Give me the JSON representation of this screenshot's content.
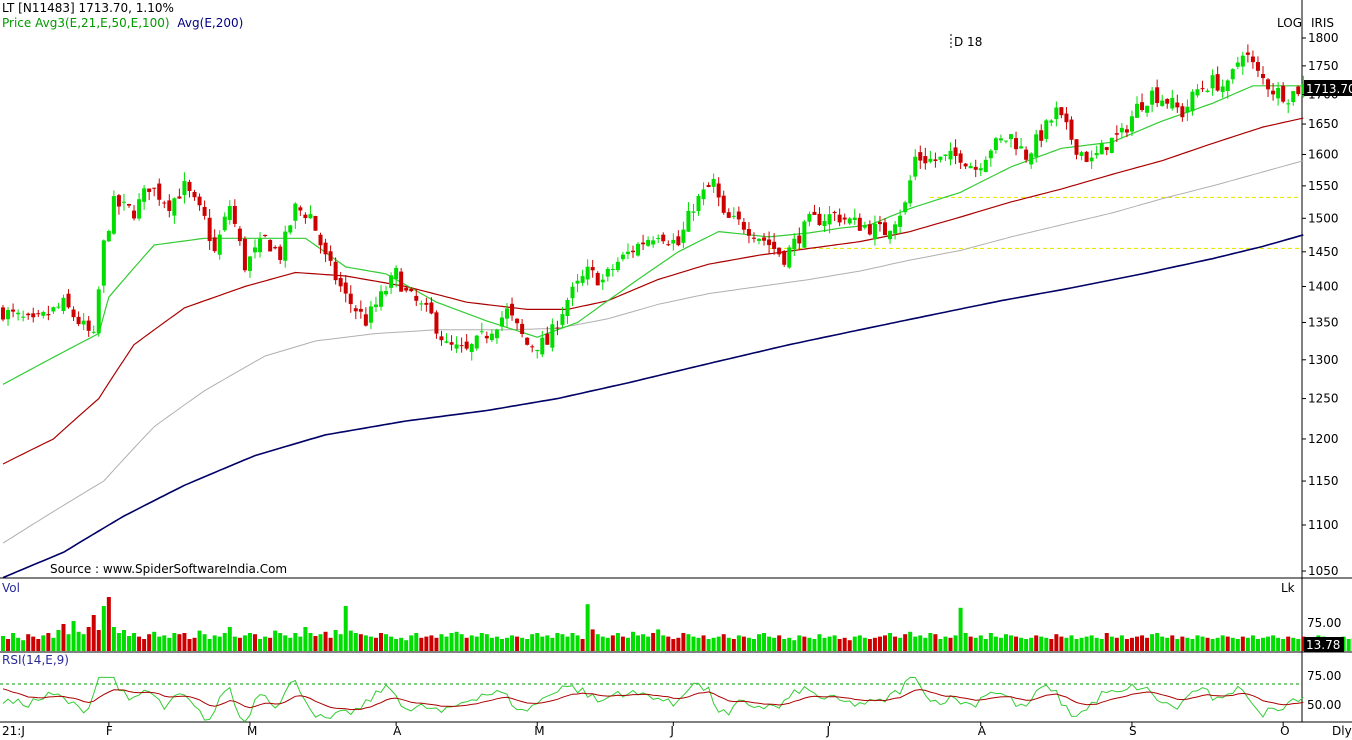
{
  "header": {
    "symbol": "LT [N11483]",
    "last_price": "1713.70",
    "change_pct": "1.10%",
    "price_label": "Price",
    "avg3_label": "Avg3(E,21,E,50,E,100)",
    "avg_label": "Avg(E,200)",
    "log_label": "LOG",
    "provider": "IRIS",
    "annotation": "D 18",
    "source": "Source : www.SpiderSoftwareIndia.Com"
  },
  "volume_panel": {
    "label": "Vol",
    "unit": "Lk",
    "last_value": "13.78",
    "tick": "75.00"
  },
  "rsi_panel": {
    "label": "RSI(14,E,9)",
    "ticks": [
      "75.00",
      "50.00"
    ]
  },
  "bottom_axis": {
    "start_label": "21:J",
    "period": "Dly"
  },
  "colors": {
    "up": "#00dd00",
    "down": "#cc0000",
    "ema21": "#33cc33",
    "ema50": "#aa0000",
    "ema100": "#b0b0b0",
    "ema200": "#000066",
    "support": "#e8e800",
    "text_blue": "#000080"
  },
  "chart_data": {
    "type": "candlestick",
    "scale": "log",
    "ylim": [
      1040,
      1820
    ],
    "y_ticks": [
      1800,
      1750,
      1700,
      1650,
      1600,
      1550,
      1500,
      1450,
      1400,
      1350,
      1300,
      1250,
      1200,
      1150,
      1100,
      1050
    ],
    "x_months": [
      {
        "label": "F",
        "index": 21
      },
      {
        "label": "M",
        "index": 49
      },
      {
        "label": "A",
        "index": 78
      },
      {
        "label": "M",
        "index": 106
      },
      {
        "label": "J",
        "index": 133
      },
      {
        "label": "J",
        "index": 164
      },
      {
        "label": "A",
        "index": 194
      },
      {
        "label": "S",
        "index": 224
      },
      {
        "label": "O",
        "index": 254
      }
    ],
    "ohlc_anchors": [
      [
        0,
        1365
      ],
      [
        6,
        1348
      ],
      [
        12,
        1375
      ],
      [
        18,
        1328
      ],
      [
        20,
        1460
      ],
      [
        22,
        1522
      ],
      [
        26,
        1510
      ],
      [
        29,
        1550
      ],
      [
        33,
        1522
      ],
      [
        36,
        1548
      ],
      [
        40,
        1498
      ],
      [
        42,
        1448
      ],
      [
        45,
        1520
      ],
      [
        48,
        1430
      ],
      [
        52,
        1468
      ],
      [
        55,
        1445
      ],
      [
        58,
        1515
      ],
      [
        61,
        1505
      ],
      [
        64,
        1440
      ],
      [
        68,
        1385
      ],
      [
        72,
        1352
      ],
      [
        75,
        1385
      ],
      [
        78,
        1418
      ],
      [
        80,
        1390
      ],
      [
        85,
        1358
      ],
      [
        88,
        1318
      ],
      [
        92,
        1310
      ],
      [
        96,
        1335
      ],
      [
        100,
        1365
      ],
      [
        104,
        1320
      ],
      [
        108,
        1322
      ],
      [
        112,
        1382
      ],
      [
        116,
        1420
      ],
      [
        119,
        1408
      ],
      [
        122,
        1435
      ],
      [
        126,
        1460
      ],
      [
        130,
        1480
      ],
      [
        134,
        1460
      ],
      [
        137,
        1520
      ],
      [
        141,
        1555
      ],
      [
        143,
        1500
      ],
      [
        147,
        1490
      ],
      [
        151,
        1468
      ],
      [
        155,
        1442
      ],
      [
        160,
        1495
      ],
      [
        165,
        1505
      ],
      [
        170,
        1490
      ],
      [
        175,
        1480
      ],
      [
        179,
        1520
      ],
      [
        181,
        1595
      ],
      [
        185,
        1590
      ],
      [
        190,
        1598
      ],
      [
        193,
        1578
      ],
      [
        196,
        1612
      ],
      [
        200,
        1630
      ],
      [
        203,
        1598
      ],
      [
        206,
        1632
      ],
      [
        209,
        1670
      ],
      [
        213,
        1612
      ],
      [
        216,
        1588
      ],
      [
        219,
        1618
      ],
      [
        222,
        1632
      ],
      [
        225,
        1678
      ],
      [
        228,
        1702
      ],
      [
        231,
        1690
      ],
      [
        234,
        1668
      ],
      [
        237,
        1708
      ],
      [
        240,
        1722
      ],
      [
        243,
        1712
      ],
      [
        246,
        1780
      ],
      [
        249,
        1735
      ],
      [
        252,
        1708
      ],
      [
        255,
        1698
      ],
      [
        258,
        1714
      ]
    ],
    "ema21": [
      [
        0,
        1268
      ],
      [
        19,
        1335
      ],
      [
        21,
        1385
      ],
      [
        30,
        1460
      ],
      [
        40,
        1470
      ],
      [
        50,
        1470
      ],
      [
        60,
        1470
      ],
      [
        68,
        1428
      ],
      [
        76,
        1418
      ],
      [
        86,
        1378
      ],
      [
        96,
        1352
      ],
      [
        106,
        1330
      ],
      [
        114,
        1350
      ],
      [
        124,
        1400
      ],
      [
        134,
        1450
      ],
      [
        142,
        1480
      ],
      [
        152,
        1472
      ],
      [
        160,
        1478
      ],
      [
        166,
        1485
      ],
      [
        172,
        1490
      ],
      [
        180,
        1515
      ],
      [
        190,
        1540
      ],
      [
        200,
        1580
      ],
      [
        210,
        1610
      ],
      [
        220,
        1620
      ],
      [
        230,
        1655
      ],
      [
        240,
        1685
      ],
      [
        248,
        1715
      ],
      [
        258,
        1715
      ]
    ],
    "ema50": [
      [
        0,
        1170
      ],
      [
        10,
        1200
      ],
      [
        19,
        1250
      ],
      [
        26,
        1320
      ],
      [
        36,
        1370
      ],
      [
        48,
        1400
      ],
      [
        58,
        1420
      ],
      [
        68,
        1415
      ],
      [
        80,
        1400
      ],
      [
        92,
        1378
      ],
      [
        104,
        1368
      ],
      [
        112,
        1368
      ],
      [
        120,
        1380
      ],
      [
        130,
        1410
      ],
      [
        140,
        1432
      ],
      [
        150,
        1445
      ],
      [
        160,
        1455
      ],
      [
        170,
        1465
      ],
      [
        180,
        1480
      ],
      [
        190,
        1502
      ],
      [
        200,
        1525
      ],
      [
        210,
        1545
      ],
      [
        220,
        1568
      ],
      [
        230,
        1590
      ],
      [
        240,
        1618
      ],
      [
        250,
        1645
      ],
      [
        258,
        1660
      ]
    ],
    "ema100": [
      [
        0,
        1080
      ],
      [
        20,
        1150
      ],
      [
        30,
        1215
      ],
      [
        40,
        1260
      ],
      [
        52,
        1305
      ],
      [
        62,
        1325
      ],
      [
        74,
        1335
      ],
      [
        86,
        1340
      ],
      [
        100,
        1340
      ],
      [
        110,
        1342
      ],
      [
        120,
        1355
      ],
      [
        130,
        1375
      ],
      [
        140,
        1390
      ],
      [
        150,
        1400
      ],
      [
        160,
        1410
      ],
      [
        170,
        1422
      ],
      [
        180,
        1438
      ],
      [
        190,
        1452
      ],
      [
        200,
        1472
      ],
      [
        210,
        1490
      ],
      [
        220,
        1508
      ],
      [
        230,
        1530
      ],
      [
        240,
        1550
      ],
      [
        250,
        1572
      ],
      [
        258,
        1590
      ]
    ],
    "ema200": [
      [
        0,
        1043
      ],
      [
        12,
        1070
      ],
      [
        24,
        1110
      ],
      [
        36,
        1145
      ],
      [
        50,
        1180
      ],
      [
        64,
        1205
      ],
      [
        80,
        1222
      ],
      [
        96,
        1235
      ],
      [
        110,
        1250
      ],
      [
        124,
        1270
      ],
      [
        140,
        1295
      ],
      [
        156,
        1320
      ],
      [
        170,
        1340
      ],
      [
        184,
        1360
      ],
      [
        198,
        1380
      ],
      [
        212,
        1398
      ],
      [
        226,
        1418
      ],
      [
        240,
        1440
      ],
      [
        250,
        1458
      ],
      [
        258,
        1475
      ]
    ],
    "support_levels": [
      1532,
      1455
    ],
    "volume": {
      "ylim": [
        0,
        100
      ],
      "values": [
        25,
        20,
        30,
        22,
        18,
        28,
        24,
        20,
        26,
        30,
        22,
        35,
        45,
        28,
        50,
        32,
        28,
        40,
        60,
        35,
        75,
        90,
        40,
        30,
        35,
        25,
        30,
        24,
        20,
        28,
        32,
        24,
        26,
        22,
        30,
        28,
        30,
        20,
        22,
        34,
        28,
        20,
        26,
        24,
        30,
        40,
        24,
        22,
        26,
        30,
        28,
        20,
        24,
        22,
        34,
        30,
        26,
        22,
        30,
        24,
        40,
        30,
        25,
        28,
        32,
        22,
        35,
        28,
        75,
        34,
        30,
        28,
        26,
        24,
        22,
        30,
        28,
        24,
        20,
        22,
        18,
        26,
        30,
        22,
        24,
        26,
        22,
        28,
        24,
        30,
        32,
        28,
        22,
        26,
        24,
        30,
        28,
        22,
        24,
        20,
        22,
        26,
        24,
        22,
        20,
        28,
        30,
        24,
        26,
        22,
        30,
        28,
        24,
        30,
        26,
        20,
        78,
        36,
        28,
        24,
        22,
        26,
        30,
        24,
        22,
        32,
        26,
        28,
        24,
        30,
        36,
        26,
        24,
        20,
        22,
        30,
        28,
        24,
        22,
        26,
        20,
        22,
        24,
        28,
        22,
        20,
        26,
        24,
        22,
        20,
        28,
        30,
        24,
        22,
        26,
        20,
        22,
        18,
        26,
        24,
        22,
        20,
        28,
        22,
        24,
        26,
        20,
        22,
        18,
        24,
        26,
        22,
        20,
        22,
        24,
        26,
        30,
        24,
        22,
        28,
        32,
        24,
        26,
        22,
        30,
        28,
        20,
        24,
        22,
        26,
        72,
        30,
        24,
        22,
        26,
        20,
        30,
        24,
        22,
        28,
        26,
        24,
        22,
        20,
        22,
        26,
        24,
        22,
        20,
        28,
        24,
        22,
        26,
        20,
        22,
        24,
        26,
        22,
        20,
        30,
        24,
        22,
        26,
        20,
        22,
        24,
        26,
        22,
        28,
        30,
        24,
        22,
        26,
        20,
        24,
        22,
        20,
        26,
        24,
        22,
        20,
        22,
        26,
        24,
        22,
        20,
        24,
        22,
        26,
        20,
        22,
        24,
        26,
        22,
        20,
        24,
        22,
        20,
        24,
        22,
        20,
        26,
        24,
        22,
        20,
        22,
        24,
        20,
        22,
        20
      ]
    },
    "rsi": {
      "ylim": [
        30,
        85
      ],
      "levels": [
        75,
        50
      ],
      "overbought": 70
    }
  }
}
